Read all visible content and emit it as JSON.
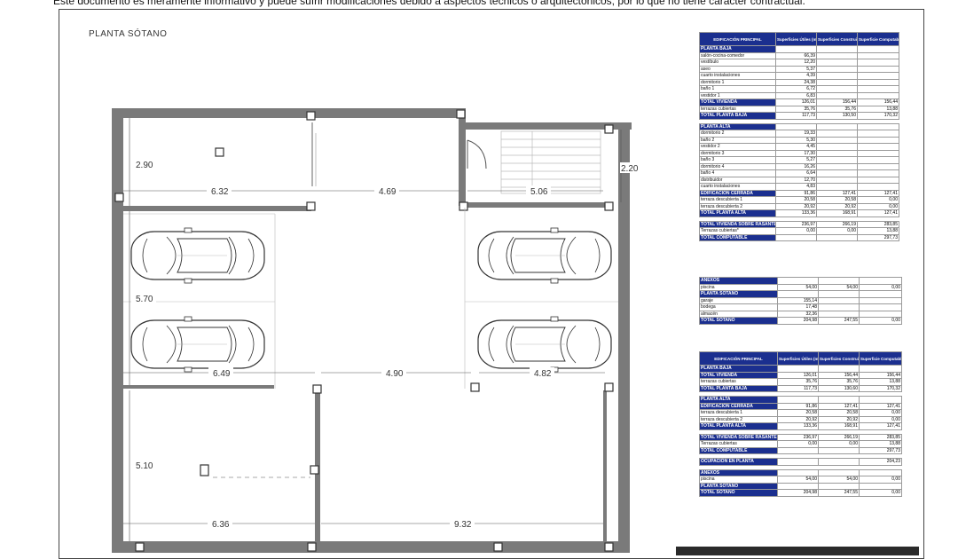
{
  "disclaimer": "Este documento es meramente informativo y puede sufrir modificaciones debido a aspectos técnicos o arquitectónicos, por lo que no tiene carácter contractual.",
  "plan": {
    "title": "PLANTA SÓTANO",
    "dims": {
      "d632": "6.32",
      "d469": "4.69",
      "d506": "5.06",
      "d290": "2.90",
      "d220": "2.20",
      "d570": "5.70",
      "d649": "6.49",
      "d490": "4.90",
      "d482": "4.82",
      "d510": "5.10",
      "d636": "6.36",
      "d932": "9.32"
    }
  },
  "table1": {
    "headers": [
      "EDIFICACIÓN PRINCIPAL",
      "Superficies Útiles (m²)",
      "Superficies Construidas (m²)",
      "Superficie Computable (m²/t)"
    ],
    "rows": [
      [
        "PLANTA BAJA",
        "",
        "",
        "",
        "blue"
      ],
      [
        "salón-cocina-comedor",
        "66,39",
        "",
        "",
        ""
      ],
      [
        "vestíbulo",
        "12,20",
        "",
        "",
        ""
      ],
      [
        "aseo",
        "5,37",
        "",
        "",
        ""
      ],
      [
        "cuarto instalaciones",
        "4,39",
        "",
        "",
        ""
      ],
      [
        "dormitorio 1",
        "24,38",
        "",
        "",
        ""
      ],
      [
        "baño 1",
        "6,72",
        "",
        "",
        ""
      ],
      [
        "vestidor 1",
        "6,83",
        "",
        "",
        ""
      ],
      [
        "TOTAL VIVIENDA",
        "126,01",
        "156,44",
        "156,44",
        "blue"
      ],
      [
        "terrazas cubiertas",
        "35,76",
        "35,76",
        "13,88",
        ""
      ],
      [
        "TOTAL PLANTA BAJA",
        "117,73",
        "130,50",
        "170,32",
        "blue"
      ],
      [
        "",
        "",
        "",
        "",
        "gap"
      ],
      [
        "PLANTA ALTA",
        "",
        "",
        "",
        "blue"
      ],
      [
        "dormitorio 2",
        "19,33",
        "",
        "",
        ""
      ],
      [
        "baño 2",
        "5,30",
        "",
        "",
        ""
      ],
      [
        "vestidor 2",
        "4,45",
        "",
        "",
        ""
      ],
      [
        "dormitorio 3",
        "17,30",
        "",
        "",
        ""
      ],
      [
        "baño 3",
        "5,27",
        "",
        "",
        ""
      ],
      [
        "dormitorio 4",
        "16,26",
        "",
        "",
        ""
      ],
      [
        "baño 4",
        "6,64",
        "",
        "",
        ""
      ],
      [
        "distribuidor",
        "12,70",
        "",
        "",
        ""
      ],
      [
        "cuarto instalaciones",
        "4,83",
        "",
        "",
        ""
      ],
      [
        "EDIFICACIÓN CERRADA",
        "91,86",
        "127,41",
        "127,41",
        "blue"
      ],
      [
        "terraza descubierta 1",
        "20,58",
        "20,58",
        "0,00",
        ""
      ],
      [
        "terraza descubierta 2",
        "20,92",
        "20,92",
        "0,00",
        ""
      ],
      [
        "TOTAL PLANTA ALTA",
        "133,36",
        "168,91",
        "127,41",
        "blue"
      ],
      [
        "",
        "",
        "",
        "",
        "gap"
      ],
      [
        "TOTAL VIVIENDA SOBRE RASANTE",
        "236,97",
        "266,19",
        "283,85",
        "blue"
      ],
      [
        "Terrazas cubiertas*",
        "0,00",
        "0,00",
        "13,88",
        ""
      ],
      [
        "TOTAL COMPUTABLE",
        "",
        "",
        "297,73",
        "blue"
      ]
    ]
  },
  "table2": {
    "rows": [
      [
        "ANEXOS",
        "",
        "",
        "",
        "blue"
      ],
      [
        "piscina",
        "54,00",
        "54,00",
        "0,00",
        ""
      ],
      [
        "PLANTA SÓTANO",
        "",
        "",
        "",
        "blue"
      ],
      [
        "garaje",
        "155,14",
        "",
        "",
        ""
      ],
      [
        "bodega",
        "17,48",
        "",
        "",
        ""
      ],
      [
        "almacén",
        "32,36",
        "",
        "",
        ""
      ],
      [
        "TOTAL SÓTANO",
        "204,98",
        "247,55",
        "0,00",
        "blue"
      ]
    ]
  },
  "table3": {
    "headers": [
      "EDIFICACIÓN PRINCIPAL",
      "Superficies Útiles (m²)",
      "Superficies Construidas (m²)",
      "Superficie Computable (m²/t)"
    ],
    "rows": [
      [
        "PLANTA BAJA",
        "",
        "",
        "",
        "blue"
      ],
      [
        "TOTAL VIVIENDA",
        "126,01",
        "156,44",
        "156,44",
        "blue"
      ],
      [
        "terrazas cubiertas",
        "35,76",
        "35,76",
        "13,88",
        ""
      ],
      [
        "TOTAL PLANTA BAJA",
        "117,73",
        "130,60",
        "170,32",
        "blue"
      ],
      [
        "",
        "",
        "",
        "",
        "gap"
      ],
      [
        "PLANTA ALTA",
        "",
        "",
        "",
        "blue"
      ],
      [
        "EDIFICACIÓN CERRADA",
        "91,86",
        "127,41",
        "127,41",
        "blue"
      ],
      [
        "terraza descubierta 1",
        "20,58",
        "20,58",
        "0,00",
        ""
      ],
      [
        "terraza descubierta 2",
        "20,92",
        "20,92",
        "0,00",
        ""
      ],
      [
        "TOTAL PLANTA ALTA",
        "133,36",
        "168,91",
        "127,41",
        "blue"
      ],
      [
        "",
        "",
        "",
        "",
        "gap"
      ],
      [
        "TOTAL VIVIENDA SOBRE RASANTE",
        "236,97",
        "266,19",
        "283,85",
        "blue"
      ],
      [
        "Terrazas cubiertas",
        "0,00",
        "0,00",
        "13,88",
        ""
      ],
      [
        "TOTAL COMPUTABLE",
        "",
        "",
        "297,73",
        "blue"
      ],
      [
        "",
        "",
        "",
        "",
        "gap"
      ],
      [
        "OCUPACIÓN EN PLANTA",
        "",
        "",
        "204,23",
        "blue"
      ],
      [
        "",
        "",
        "",
        "",
        "gap"
      ],
      [
        "ANEXOS",
        "",
        "",
        "",
        "blue"
      ],
      [
        "piscina",
        "54,00",
        "54,00",
        "0,00",
        ""
      ],
      [
        "PLANTA SÓTANO",
        "",
        "",
        "",
        "blue"
      ],
      [
        "TOTAL SÓTANO",
        "204,98",
        "247,55",
        "0,00",
        "blue"
      ]
    ]
  }
}
